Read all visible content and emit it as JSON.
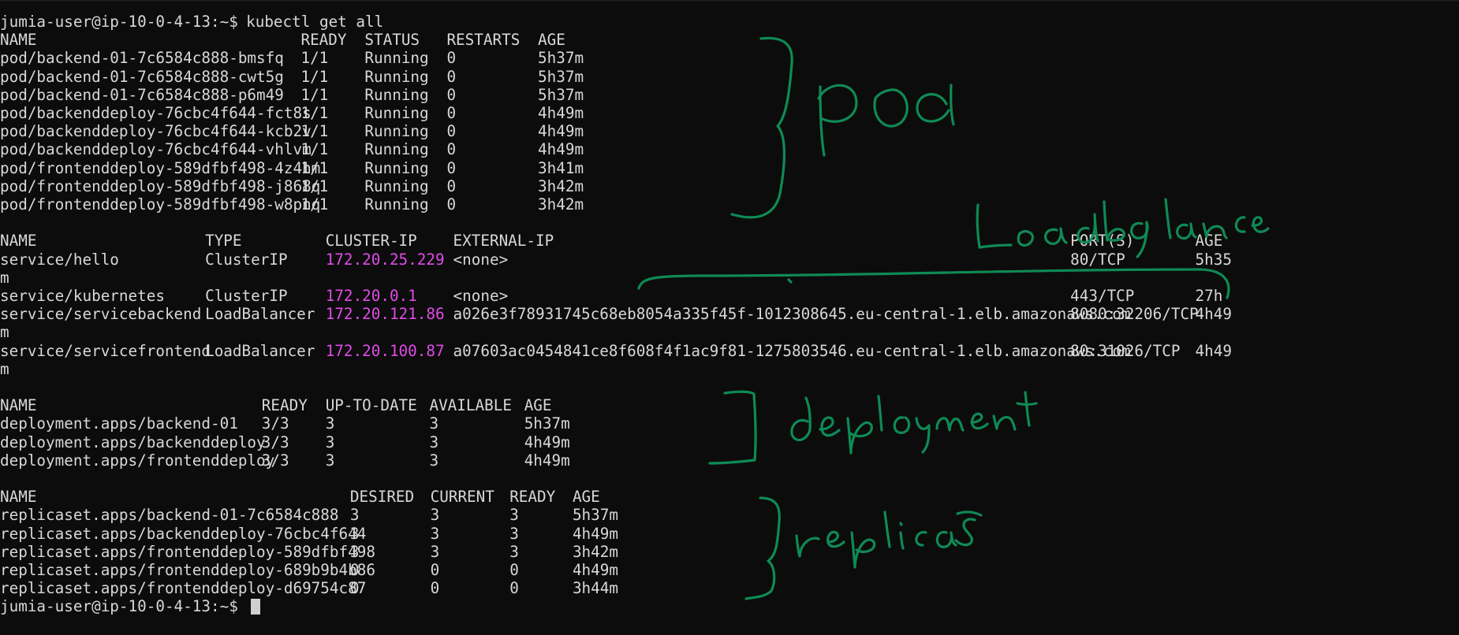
{
  "terminal": {
    "prompt": "jumia-user@ip-10-0-4-13:~$",
    "command": "kubectl get all",
    "end_prompt": "jumia-user@ip-10-0-4-13:~$"
  },
  "colors": {
    "background": "#0c0c0c",
    "text": "#d8d8d8",
    "cluster_ip": "#e14be8",
    "annotation_ink": "#0f8a55"
  },
  "pods": {
    "headers": [
      "NAME",
      "READY",
      "STATUS",
      "RESTARTS",
      "AGE"
    ],
    "rows": [
      [
        "pod/backend-01-7c6584c888-bmsfq",
        "1/1",
        "Running",
        "0",
        "5h37m"
      ],
      [
        "pod/backend-01-7c6584c888-cwt5g",
        "1/1",
        "Running",
        "0",
        "5h37m"
      ],
      [
        "pod/backend-01-7c6584c888-p6m49",
        "1/1",
        "Running",
        "0",
        "5h37m"
      ],
      [
        "pod/backenddeploy-76cbc4f644-fct8s",
        "1/1",
        "Running",
        "0",
        "4h49m"
      ],
      [
        "pod/backenddeploy-76cbc4f644-kcb2v",
        "1/1",
        "Running",
        "0",
        "4h49m"
      ],
      [
        "pod/backenddeploy-76cbc4f644-vhlvm",
        "1/1",
        "Running",
        "0",
        "4h49m"
      ],
      [
        "pod/frontenddeploy-589dfbf498-4z4hm",
        "1/1",
        "Running",
        "0",
        "3h41m"
      ],
      [
        "pod/frontenddeploy-589dfbf498-j868q",
        "1/1",
        "Running",
        "0",
        "3h42m"
      ],
      [
        "pod/frontenddeploy-589dfbf498-w8pnq",
        "1/1",
        "Running",
        "0",
        "3h42m"
      ]
    ]
  },
  "services": {
    "headers": [
      "NAME",
      "TYPE",
      "CLUSTER-IP",
      "EXTERNAL-IP",
      "PORT(S)",
      "AGE"
    ],
    "rows": [
      [
        "service/hello",
        "ClusterIP",
        "172.20.25.229",
        "<none>",
        "80/TCP",
        "5h35",
        "m"
      ],
      [
        "service/kubernetes",
        "ClusterIP",
        "172.20.0.1",
        "<none>",
        "443/TCP",
        "27h",
        ""
      ],
      [
        "service/servicebackend",
        "LoadBalancer",
        "172.20.121.86",
        "a026e3f78931745c68eb8054a335f45f-1012308645.eu-central-1.elb.amazonaws.com",
        "8080:32206/TCP",
        "4h49",
        "m"
      ],
      [
        "service/servicefrontend",
        "LoadBalancer",
        "172.20.100.87",
        "a07603ac0454841ce8f608f4f1ac9f81-1275803546.eu-central-1.elb.amazonaws.com",
        "80:31026/TCP",
        "4h49",
        "m"
      ]
    ]
  },
  "deployments": {
    "headers": [
      "NAME",
      "READY",
      "UP-TO-DATE",
      "AVAILABLE",
      "AGE"
    ],
    "rows": [
      [
        "deployment.apps/backend-01",
        "3/3",
        "3",
        "3",
        "5h37m"
      ],
      [
        "deployment.apps/backenddeploy",
        "3/3",
        "3",
        "3",
        "4h49m"
      ],
      [
        "deployment.apps/frontenddeploy",
        "3/3",
        "3",
        "3",
        "4h49m"
      ]
    ]
  },
  "replicasets": {
    "headers": [
      "NAME",
      "DESIRED",
      "CURRENT",
      "READY",
      "AGE"
    ],
    "rows": [
      [
        "replicaset.apps/backend-01-7c6584c888",
        "3",
        "3",
        "3",
        "5h37m"
      ],
      [
        "replicaset.apps/backenddeploy-76cbc4f644",
        "3",
        "3",
        "3",
        "4h49m"
      ],
      [
        "replicaset.apps/frontenddeploy-589dfbf498",
        "3",
        "3",
        "3",
        "3h42m"
      ],
      [
        "replicaset.apps/frontenddeploy-689b9b4b86",
        "0",
        "0",
        "0",
        "4h49m"
      ],
      [
        "replicaset.apps/frontenddeploy-d69754c87",
        "0",
        "0",
        "0",
        "3h44m"
      ]
    ]
  },
  "annotations": {
    "pod_label": "pod",
    "service_label": "Loadbalance",
    "deployment_label": "deployment",
    "replicaset_label": "replicas"
  }
}
